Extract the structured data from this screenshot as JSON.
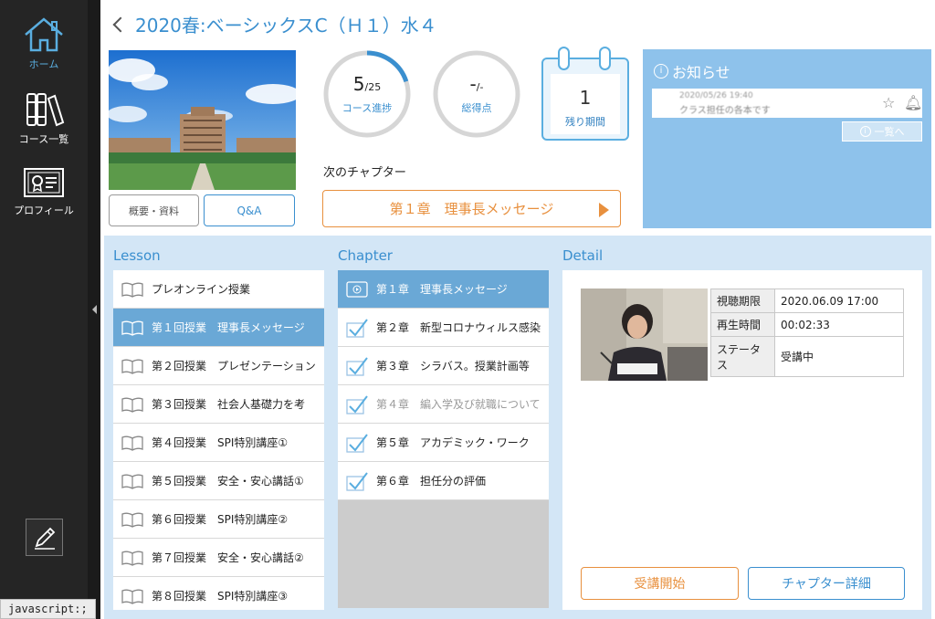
{
  "sidebar": {
    "items": [
      {
        "label": "ホーム",
        "icon": "home-icon",
        "active": true
      },
      {
        "label": "コース一覧",
        "icon": "books-icon",
        "active": false
      },
      {
        "label": "プロフィール",
        "icon": "certificate-icon",
        "active": false
      }
    ],
    "edit_icon": "pencil-icon"
  },
  "status_bar": {
    "text": "javascript:;"
  },
  "header": {
    "title": "2020春:ベーシックスC（Ｈ１）水４"
  },
  "course": {
    "overview_label": "概要・資料",
    "qa_label": "Q&A",
    "progress": {
      "value": "5",
      "total": "/25",
      "label": "コース進捗",
      "fraction": 0.2
    },
    "score": {
      "value": "-",
      "total": "/-",
      "label": "総得点"
    },
    "remaining": {
      "value": "1",
      "label": "残り期間"
    },
    "next_chapter_label": "次のチャプター",
    "next_chapter_button": "第１章　理事長メッセージ"
  },
  "notices": {
    "title": "お知らせ",
    "item": {
      "date": "2020/05/26 19:40",
      "text": "クラス担任の各本です"
    },
    "list_button": "一覧へ"
  },
  "lesson": {
    "title": "Lesson",
    "items": [
      {
        "label": "プレオンライン授業"
      },
      {
        "label": "第１回授業　理事長メッセージ",
        "selected": true
      },
      {
        "label": "第２回授業　プレゼンテーション"
      },
      {
        "label": "第３回授業　社会人基礎力を考"
      },
      {
        "label": "第４回授業　SPI特別講座①"
      },
      {
        "label": "第５回授業　安全・安心講話①"
      },
      {
        "label": "第６回授業　SPI特別講座②"
      },
      {
        "label": "第７回授業　安全・安心講話②"
      },
      {
        "label": "第８回授業　SPI特別講座③"
      }
    ]
  },
  "chapter": {
    "title": "Chapter",
    "items": [
      {
        "label": "第１章　理事長メッセージ",
        "selected": true
      },
      {
        "label": "第２章　新型コロナウィルス感染"
      },
      {
        "label": "第３章　シラバス。授業計画等"
      },
      {
        "label": "第４章　編入学及び就職について",
        "dim": true
      },
      {
        "label": "第５章　アカデミック・ワーク"
      },
      {
        "label": "第６章　担任分の評価"
      }
    ]
  },
  "detail": {
    "title": "Detail",
    "rows": [
      {
        "key": "視聴期限",
        "value": "2020.06.09 17:00"
      },
      {
        "key": "再生時間",
        "value": "00:02:33"
      },
      {
        "key": "ステータス",
        "value": "受講中"
      }
    ],
    "start_button": "受講開始",
    "chapter_detail_button": "チャプター詳細"
  },
  "colors": {
    "accent": "#3a8fcf",
    "orange": "#e8903e",
    "panel": "#8ec2eb",
    "sidebar": "#252525"
  }
}
